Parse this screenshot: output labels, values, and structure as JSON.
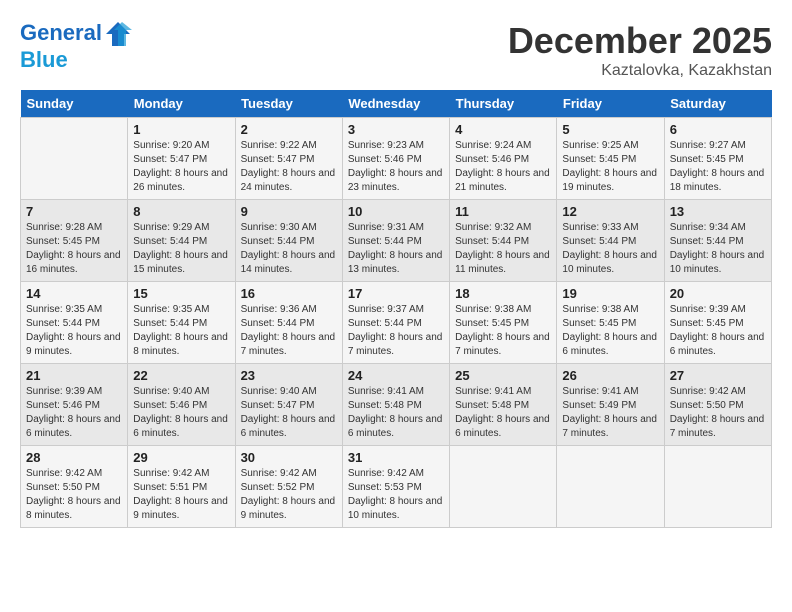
{
  "header": {
    "logo_line1": "General",
    "logo_line2": "Blue",
    "month": "December 2025",
    "location": "Kaztalovka, Kazakhstan"
  },
  "weekdays": [
    "Sunday",
    "Monday",
    "Tuesday",
    "Wednesday",
    "Thursday",
    "Friday",
    "Saturday"
  ],
  "weeks": [
    [
      {
        "day": "",
        "sunrise": "",
        "sunset": "",
        "daylight": ""
      },
      {
        "day": "1",
        "sunrise": "9:20 AM",
        "sunset": "5:47 PM",
        "daylight": "8 hours and 26 minutes."
      },
      {
        "day": "2",
        "sunrise": "9:22 AM",
        "sunset": "5:47 PM",
        "daylight": "8 hours and 24 minutes."
      },
      {
        "day": "3",
        "sunrise": "9:23 AM",
        "sunset": "5:46 PM",
        "daylight": "8 hours and 23 minutes."
      },
      {
        "day": "4",
        "sunrise": "9:24 AM",
        "sunset": "5:46 PM",
        "daylight": "8 hours and 21 minutes."
      },
      {
        "day": "5",
        "sunrise": "9:25 AM",
        "sunset": "5:45 PM",
        "daylight": "8 hours and 19 minutes."
      },
      {
        "day": "6",
        "sunrise": "9:27 AM",
        "sunset": "5:45 PM",
        "daylight": "8 hours and 18 minutes."
      }
    ],
    [
      {
        "day": "7",
        "sunrise": "9:28 AM",
        "sunset": "5:45 PM",
        "daylight": "8 hours and 16 minutes."
      },
      {
        "day": "8",
        "sunrise": "9:29 AM",
        "sunset": "5:44 PM",
        "daylight": "8 hours and 15 minutes."
      },
      {
        "day": "9",
        "sunrise": "9:30 AM",
        "sunset": "5:44 PM",
        "daylight": "8 hours and 14 minutes."
      },
      {
        "day": "10",
        "sunrise": "9:31 AM",
        "sunset": "5:44 PM",
        "daylight": "8 hours and 13 minutes."
      },
      {
        "day": "11",
        "sunrise": "9:32 AM",
        "sunset": "5:44 PM",
        "daylight": "8 hours and 11 minutes."
      },
      {
        "day": "12",
        "sunrise": "9:33 AM",
        "sunset": "5:44 PM",
        "daylight": "8 hours and 10 minutes."
      },
      {
        "day": "13",
        "sunrise": "9:34 AM",
        "sunset": "5:44 PM",
        "daylight": "8 hours and 10 minutes."
      }
    ],
    [
      {
        "day": "14",
        "sunrise": "9:35 AM",
        "sunset": "5:44 PM",
        "daylight": "8 hours and 9 minutes."
      },
      {
        "day": "15",
        "sunrise": "9:35 AM",
        "sunset": "5:44 PM",
        "daylight": "8 hours and 8 minutes."
      },
      {
        "day": "16",
        "sunrise": "9:36 AM",
        "sunset": "5:44 PM",
        "daylight": "8 hours and 7 minutes."
      },
      {
        "day": "17",
        "sunrise": "9:37 AM",
        "sunset": "5:44 PM",
        "daylight": "8 hours and 7 minutes."
      },
      {
        "day": "18",
        "sunrise": "9:38 AM",
        "sunset": "5:45 PM",
        "daylight": "8 hours and 7 minutes."
      },
      {
        "day": "19",
        "sunrise": "9:38 AM",
        "sunset": "5:45 PM",
        "daylight": "8 hours and 6 minutes."
      },
      {
        "day": "20",
        "sunrise": "9:39 AM",
        "sunset": "5:45 PM",
        "daylight": "8 hours and 6 minutes."
      }
    ],
    [
      {
        "day": "21",
        "sunrise": "9:39 AM",
        "sunset": "5:46 PM",
        "daylight": "8 hours and 6 minutes."
      },
      {
        "day": "22",
        "sunrise": "9:40 AM",
        "sunset": "5:46 PM",
        "daylight": "8 hours and 6 minutes."
      },
      {
        "day": "23",
        "sunrise": "9:40 AM",
        "sunset": "5:47 PM",
        "daylight": "8 hours and 6 minutes."
      },
      {
        "day": "24",
        "sunrise": "9:41 AM",
        "sunset": "5:48 PM",
        "daylight": "8 hours and 6 minutes."
      },
      {
        "day": "25",
        "sunrise": "9:41 AM",
        "sunset": "5:48 PM",
        "daylight": "8 hours and 6 minutes."
      },
      {
        "day": "26",
        "sunrise": "9:41 AM",
        "sunset": "5:49 PM",
        "daylight": "8 hours and 7 minutes."
      },
      {
        "day": "27",
        "sunrise": "9:42 AM",
        "sunset": "5:50 PM",
        "daylight": "8 hours and 7 minutes."
      }
    ],
    [
      {
        "day": "28",
        "sunrise": "9:42 AM",
        "sunset": "5:50 PM",
        "daylight": "8 hours and 8 minutes."
      },
      {
        "day": "29",
        "sunrise": "9:42 AM",
        "sunset": "5:51 PM",
        "daylight": "8 hours and 9 minutes."
      },
      {
        "day": "30",
        "sunrise": "9:42 AM",
        "sunset": "5:52 PM",
        "daylight": "8 hours and 9 minutes."
      },
      {
        "day": "31",
        "sunrise": "9:42 AM",
        "sunset": "5:53 PM",
        "daylight": "8 hours and 10 minutes."
      },
      {
        "day": "",
        "sunrise": "",
        "sunset": "",
        "daylight": ""
      },
      {
        "day": "",
        "sunrise": "",
        "sunset": "",
        "daylight": ""
      },
      {
        "day": "",
        "sunrise": "",
        "sunset": "",
        "daylight": ""
      }
    ]
  ],
  "labels": {
    "sunrise": "Sunrise:",
    "sunset": "Sunset:",
    "daylight": "Daylight:"
  }
}
